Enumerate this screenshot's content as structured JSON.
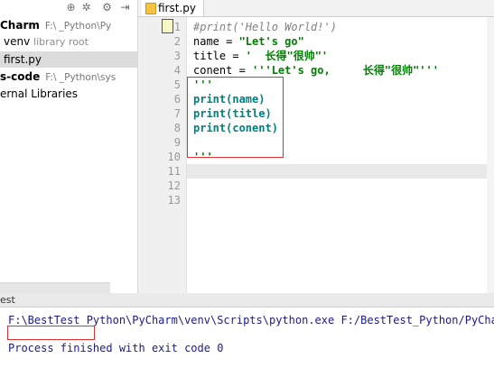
{
  "editor": {
    "tab_label": "first.py",
    "line_numbers": [
      "1",
      "2",
      "3",
      "4",
      "5",
      "6",
      "7",
      "8",
      "9",
      "10",
      "11",
      "12",
      "13"
    ],
    "code": {
      "l1": "#print('Hello World!')",
      "l2_prefix": "name = ",
      "l2_str": "\"Let's go\"",
      "l3_prefix": "title = ",
      "l3_str": "'  长得\"很帅\"'",
      "l4_prefix": "conent = ",
      "l4_str": "'''Let's go,     长得\"很帅\"'''",
      "l5": "'''",
      "l6": "print(name)",
      "l7": "print(title)",
      "l8": "print(conent)",
      "l10": "'''"
    }
  },
  "project_tree": {
    "row1_name": "Charm",
    "row1_path": "F:\\      _Python\\Py",
    "row2_name": "venv",
    "row2_sub": "library root",
    "row3_name": "first.py",
    "row4_name": "s-code",
    "row4_path": "F:\\      _Python\\sys",
    "row5_name": "ernal Libraries"
  },
  "run_panel": {
    "header_label": "est",
    "cmd_line": "F:\\BestTest_Python\\PyCharm\\venv\\Scripts\\python.exe F:/BestTest_Python/PyCha",
    "finish_line": "Process finished with exit code 0"
  },
  "colors": {
    "highlight_box": "#e03030",
    "string": "#008000",
    "comment": "#808080",
    "console_text": "#1a1a8c"
  }
}
